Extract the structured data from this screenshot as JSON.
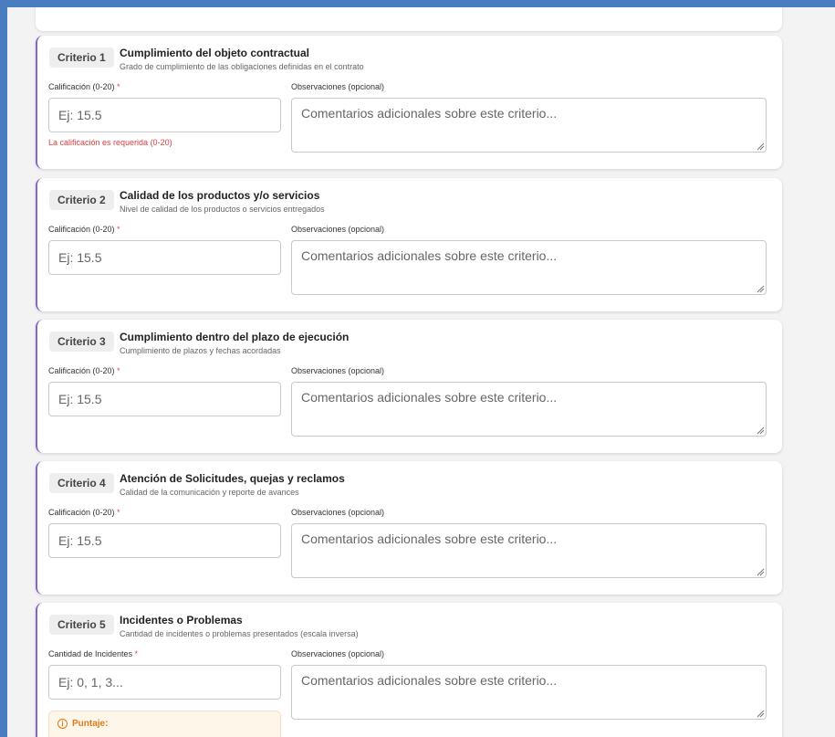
{
  "criteria": [
    {
      "badge": "Criterio 1",
      "title": "Cumplimiento del objeto contractual",
      "description": "Grado de cumplimiento de las obligaciones definidas en el contrato",
      "score_label": "Calificación (0-20)",
      "score_placeholder": "Ej: 15.5",
      "obs_label": "Observaciones (opcional)",
      "obs_placeholder": "Comentarios adicionales sobre este criterio...",
      "error": "La calificación es requerida (0-20)"
    },
    {
      "badge": "Criterio 2",
      "title": "Calidad de los productos y/o servicios",
      "description": "Nivel de calidad de los productos o servicios entregados",
      "score_label": "Calificación (0-20)",
      "score_placeholder": "Ej: 15.5",
      "obs_label": "Observaciones (opcional)",
      "obs_placeholder": "Comentarios adicionales sobre este criterio..."
    },
    {
      "badge": "Criterio 3",
      "title": "Cumplimiento dentro del plazo de ejecución",
      "description": "Cumplimiento de plazos y fechas acordadas",
      "score_label": "Calificación (0-20)",
      "score_placeholder": "Ej: 15.5",
      "obs_label": "Observaciones (opcional)",
      "obs_placeholder": "Comentarios adicionales sobre este criterio..."
    },
    {
      "badge": "Criterio 4",
      "title": "Atención de Solicitudes, quejas y reclamos",
      "description": "Calidad de la comunicación y reporte de avances",
      "score_label": "Calificación (0-20)",
      "score_placeholder": "Ej: 15.5",
      "obs_label": "Observaciones (opcional)",
      "obs_placeholder": "Comentarios adicionales sobre este criterio..."
    },
    {
      "badge": "Criterio 5",
      "title": "Incidentes o Problemas",
      "description": "Cantidad de incidentes o problemas presentados (escala inversa)",
      "score_label": "Cantidad de Incidentes",
      "score_placeholder": "Ej: 0, 1, 3...",
      "obs_label": "Observaciones (opcional)",
      "obs_placeholder": "Comentarios adicionales sobre este criterio...",
      "puntaje_label": "Puntaje:"
    }
  ],
  "required_mark": "*",
  "colors": {
    "accent_border": "#8a63d2",
    "error": "#e03b3b",
    "warning": "#e07a1a",
    "frame": "#4a7cc0"
  },
  "icons": {
    "info": "info-circle-icon",
    "resize": "resize-handle-icon"
  }
}
